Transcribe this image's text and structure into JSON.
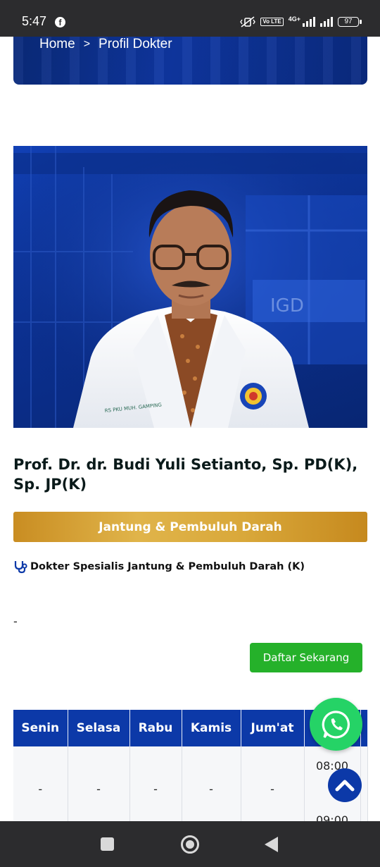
{
  "status_bar": {
    "time": "5:47",
    "app_icon": "facebook-icon",
    "network_badge": "Vo LTE",
    "network_type": "4G+",
    "battery": "97"
  },
  "breadcrumb": {
    "home": "Home",
    "separator": ">",
    "current": "Profil Dokter"
  },
  "doctor": {
    "name": "Prof. Dr. dr. Budi Yuli Setianto, Sp. PD(K), Sp. JP(K)",
    "specialty": "Jantung & Pembuluh Darah",
    "specialist_title": "Dokter Spesialis Jantung & Pembuluh Darah (K)",
    "description": "-",
    "photo_coat_text": "RS PKU MUH. GAMPING",
    "photo_sign_text": "IGD"
  },
  "actions": {
    "register_label": "Daftar Sekarang"
  },
  "schedule": {
    "headers": [
      "Senin",
      "Selasa",
      "Rabu",
      "Kamis",
      "Jum'at",
      "",
      ""
    ],
    "row": [
      "-",
      "-",
      "-",
      "-",
      "-"
    ],
    "times": [
      "08:00",
      "09:00"
    ]
  },
  "colors": {
    "primary_blue": "#0c39a8",
    "gold": "#d9a83a",
    "green": "#25b12a",
    "whatsapp": "#25d366"
  }
}
